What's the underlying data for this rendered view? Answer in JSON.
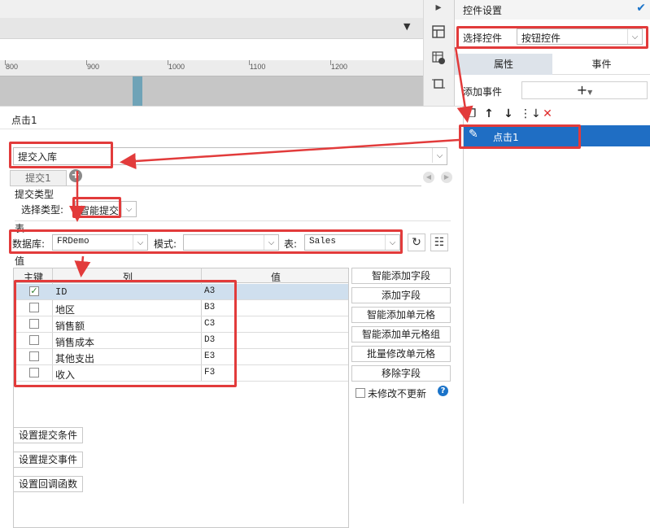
{
  "editor": {
    "ruler_ticks": [
      "800",
      "900",
      "1000",
      "1100",
      "1200"
    ]
  },
  "right_panel": {
    "title": "控件设置",
    "select_label": "选择控件",
    "select_value": "按钮控件",
    "tabs": [
      "属性",
      "事件"
    ],
    "active_tab": "事件",
    "add_event_label": "添加事件",
    "event_items": [
      "点击1"
    ]
  },
  "dialog": {
    "title": "点击1",
    "submit_type_value": "提交入库",
    "sub_tabs": [
      "提交1"
    ],
    "submit_type_section": "提交类型",
    "select_type_label": "选择类型:",
    "select_type_value": "智能提交",
    "table_section": "表",
    "database_label": "数据库:",
    "database_value": "FRDemo",
    "schema_label": "模式:",
    "schema_value": "",
    "table_label": "表:",
    "table_value": "Sales",
    "value_section": "值",
    "columns": [
      "主键",
      "列",
      "值"
    ],
    "rows": [
      {
        "key": true,
        "col": "ID",
        "val": "A3"
      },
      {
        "key": false,
        "col": "地区",
        "val": "B3"
      },
      {
        "key": false,
        "col": "销售额",
        "val": "C3"
      },
      {
        "key": false,
        "col": "销售成本",
        "val": "D3"
      },
      {
        "key": false,
        "col": "其他支出",
        "val": "E3"
      },
      {
        "key": false,
        "col": "收入",
        "val": "F3"
      }
    ],
    "side_buttons": [
      "智能添加字段",
      "添加字段",
      "智能添加单元格",
      "智能添加单元格组",
      "批量修改单元格",
      "移除字段"
    ],
    "unmodified_label": "未修改不更新",
    "bottom_buttons": [
      "设置提交条件",
      "设置提交事件",
      "设置回调函数"
    ]
  },
  "colors": {
    "accent": "#1f6ec4",
    "annotation": "#e23b3b",
    "selected_row": "#cfdfee"
  }
}
